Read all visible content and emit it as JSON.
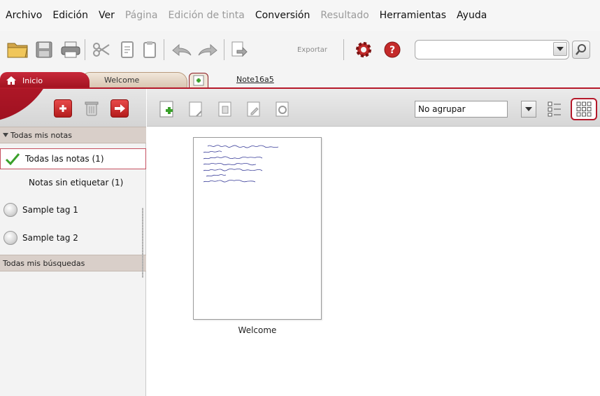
{
  "menu": {
    "items": [
      {
        "label": "Archivo",
        "enabled": true
      },
      {
        "label": "Edición",
        "enabled": true
      },
      {
        "label": "Ver",
        "enabled": true
      },
      {
        "label": "Página",
        "enabled": false
      },
      {
        "label": "Edición de tinta",
        "enabled": false
      },
      {
        "label": "Conversión",
        "enabled": true
      },
      {
        "label": "Resultado",
        "enabled": false
      },
      {
        "label": "Herramientas",
        "enabled": true
      },
      {
        "label": "Ayuda",
        "enabled": true
      }
    ]
  },
  "toolbar": {
    "export_label": "Exportar",
    "search_value": ""
  },
  "tabs": {
    "home": "Inicio",
    "welcome": "Welcome",
    "note": "Note16a5"
  },
  "sidebar": {
    "section_notes": "Todas mis notas",
    "items": [
      {
        "label": "Todas las notas (1)"
      },
      {
        "label": "Notas sin etiquetar (1)"
      },
      {
        "label": "Sample tag 1"
      },
      {
        "label": "Sample tag 2"
      }
    ],
    "section_searches": "Todas mis búsquedas"
  },
  "content": {
    "group_select": "No agrupar",
    "notes": [
      {
        "title": "Welcome"
      }
    ]
  },
  "colors": {
    "accent": "#b5192a",
    "tab_welcome": "#e3d3c2",
    "section_header": "#d9cfc9",
    "check": "#3aa02a",
    "handwriting": "#3b3f9a"
  }
}
